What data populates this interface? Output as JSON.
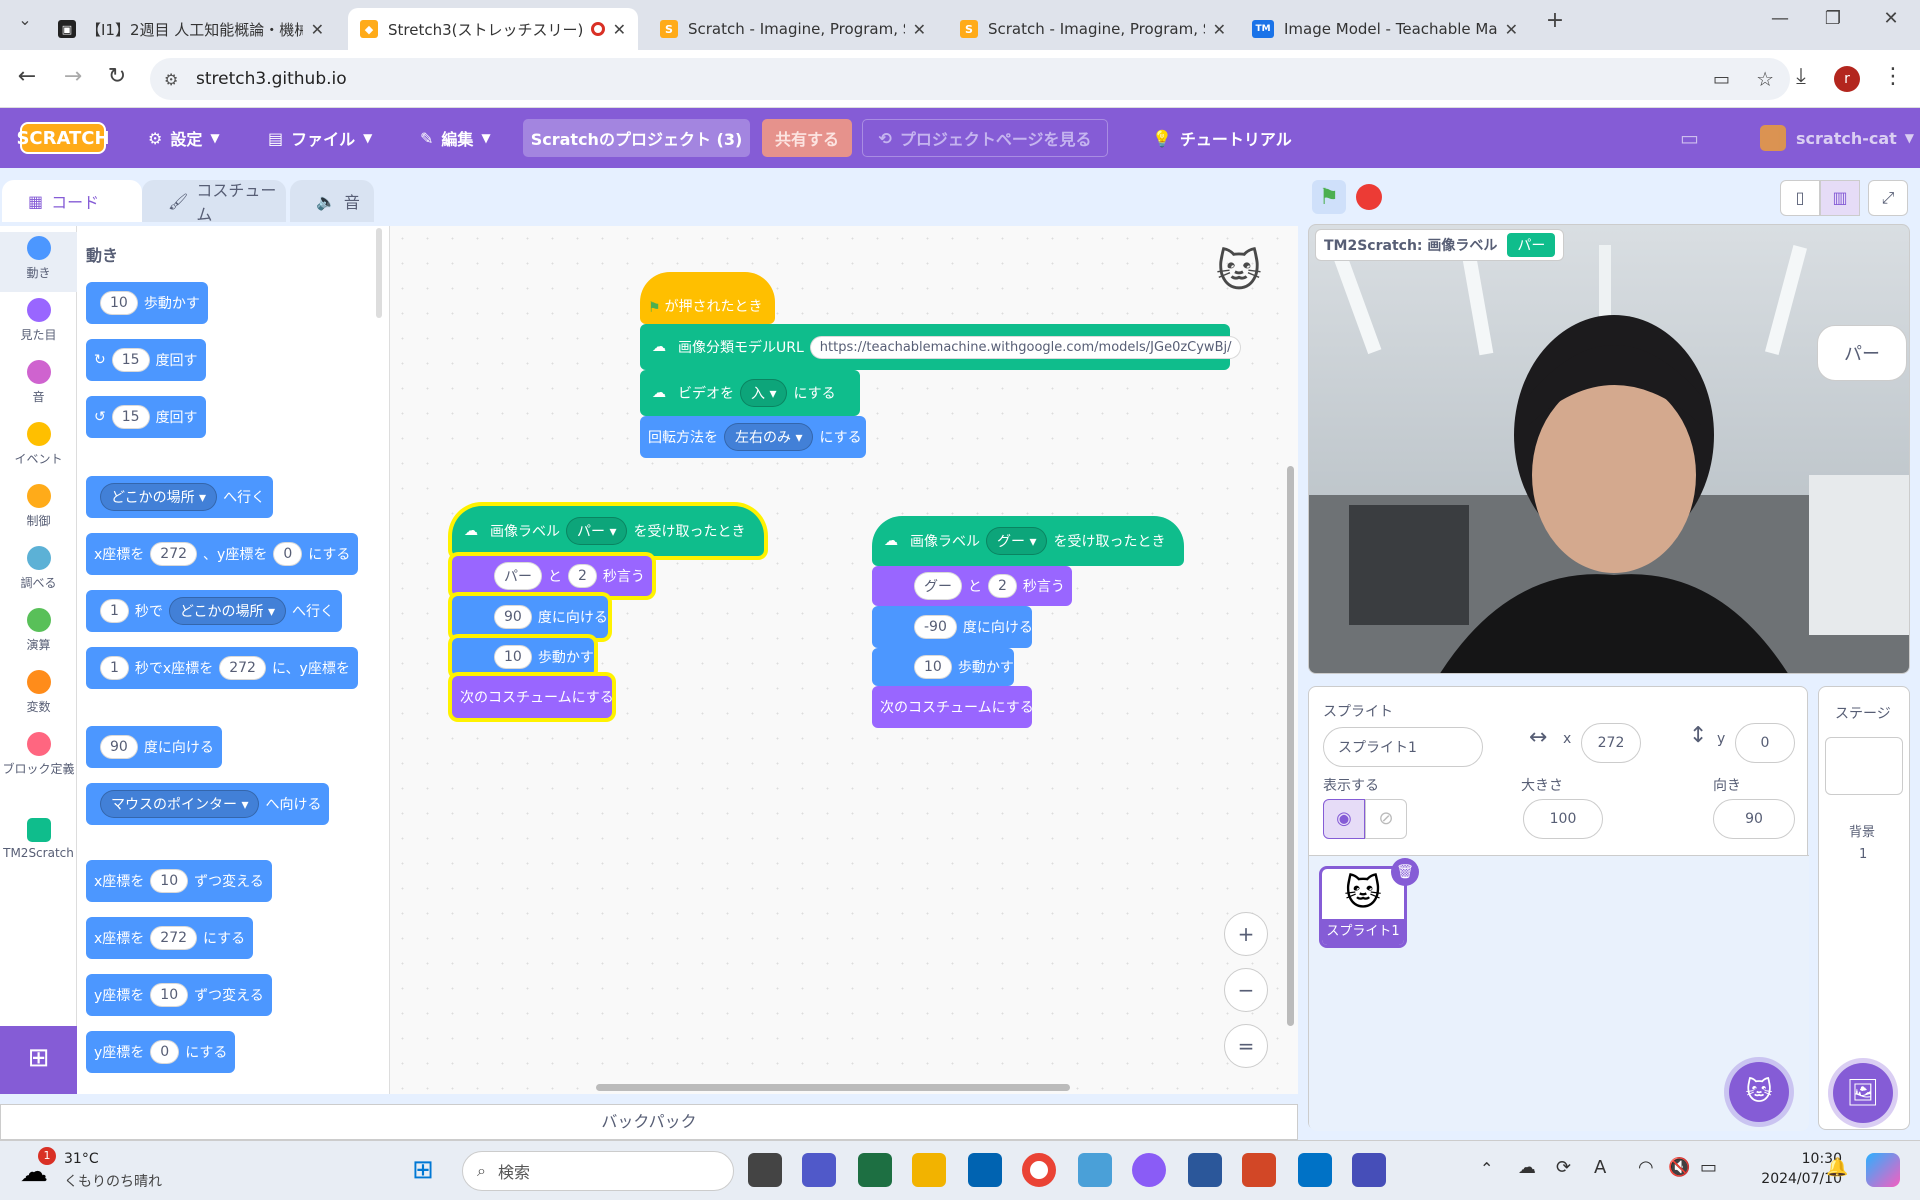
{
  "tabs": [
    {
      "title": "【I1】2週目 人工知能概論・機械学",
      "fav_color": "#222",
      "fav": "▣"
    },
    {
      "title": "Stretch3(ストレッチスリー)",
      "fav_color": "#ffab19",
      "fav": "🐱"
    },
    {
      "title": "Scratch - Imagine, Program, Sha",
      "fav_color": "#ffab19",
      "fav": "S"
    },
    {
      "title": "Scratch - Imagine, Program, Sha",
      "fav_color": "#ffab19",
      "fav": "S"
    },
    {
      "title": "Image Model - Teachable Mach",
      "fav_color": "#1a73e8",
      "fav": "TM"
    }
  ],
  "address": "stretch3.github.io",
  "profile_initial": "r",
  "menu": {
    "logo": "SCRATCH",
    "settings": "設定",
    "file": "ファイル",
    "edit": "編集",
    "project_title": "Scratchのプロジェクト (3)",
    "share": "共有する",
    "see_project": "プロジェクトページを見る",
    "tutorial": "チュートリアル",
    "user": "scratch-cat"
  },
  "editor_tabs": {
    "code": "コード",
    "costume": "コスチューム",
    "sound": "音"
  },
  "categories": [
    {
      "label": "動き",
      "color": "#4c97ff"
    },
    {
      "label": "見た目",
      "color": "#9966ff"
    },
    {
      "label": "音",
      "color": "#cf63cf"
    },
    {
      "label": "イベント",
      "color": "#ffbf00"
    },
    {
      "label": "制御",
      "color": "#ffab19"
    },
    {
      "label": "調べる",
      "color": "#5cb1d6"
    },
    {
      "label": "演算",
      "color": "#59c059"
    },
    {
      "label": "変数",
      "color": "#ff8c1a"
    },
    {
      "label": "ブロック定義",
      "color": "#ff6680"
    },
    {
      "label": "TM2Scratch",
      "color": "#0fbd8c"
    }
  ],
  "palette": {
    "heading": "動き",
    "move": {
      "val": "10",
      "text": "歩動かす"
    },
    "turn_right": {
      "val": "15",
      "text": "度回す"
    },
    "turn_left": {
      "val": "15",
      "text": "度回す"
    },
    "goto": {
      "dd": "どこかの場所",
      "text": "へ行く"
    },
    "gotoxy": {
      "a": "x座標を",
      "x": "272",
      "b": "、y座標を",
      "y": "0",
      "c": "にする"
    },
    "glide": {
      "val": "1",
      "a": "秒で",
      "dd": "どこかの場所",
      "b": "へ行く"
    },
    "glidexy": {
      "val": "1",
      "a": "秒でx座標を",
      "x": "272",
      "b": "に、y座標を"
    },
    "point": {
      "val": "90",
      "text": "度に向ける"
    },
    "towards": {
      "dd": "マウスのポインター",
      "text": "へ向ける"
    },
    "changex": {
      "a": "x座標を",
      "val": "10",
      "b": "ずつ変える"
    },
    "setx": {
      "a": "x座標を",
      "val": "272",
      "b": "にする"
    },
    "changey": {
      "a": "y座標を",
      "val": "10",
      "b": "ずつ変える"
    },
    "sety": {
      "a": "y座標を",
      "val": "0",
      "b": "にする"
    }
  },
  "script": {
    "flag_hat": "が押されたとき",
    "model_url_label": "画像分類モデルURL",
    "model_url": "https://teachablemachine.withgoogle.com/models/JGe0zCywBj/",
    "video_a": "ビデオを",
    "video_dd": "入",
    "video_b": "にする",
    "rot_a": "回転方法を",
    "rot_dd": "左右のみ",
    "rot_b": "にする",
    "g1": {
      "hat_a": "画像ラベル",
      "hat_dd": "パー",
      "hat_b": "を受け取ったとき",
      "say": "パー",
      "to": "と",
      "secs": "2",
      "say_b": "秒言う",
      "dir": "90",
      "dir_b": "度に向ける",
      "move": "10",
      "move_b": "歩動かす",
      "next": "次のコスチュームにする"
    },
    "g2": {
      "hat_a": "画像ラベル",
      "hat_dd": "グー",
      "hat_b": "を受け取ったとき",
      "say": "グー",
      "to": "と",
      "secs": "2",
      "say_b": "秒言う",
      "dir": "-90",
      "dir_b": "度に向ける",
      "move": "10",
      "move_b": "歩動かす",
      "next": "次のコスチュームにする"
    }
  },
  "zoom": {
    "in": "+",
    "out": "−",
    "reset": "="
  },
  "backpack": "バックパック",
  "stage": {
    "monitor_label": "TM2Scratch: 画像ラベル",
    "monitor_value": "パー",
    "speech": "パー"
  },
  "sprite_info": {
    "header": "スプライト",
    "name": "スプライト1",
    "x_label": "x",
    "x": "272",
    "y_label": "y",
    "y": "0",
    "show_label": "表示する",
    "size_label": "大きさ",
    "size": "100",
    "dir_label": "向き",
    "dir": "90",
    "thumb_name": "スプライト1"
  },
  "stage_pane": {
    "title": "ステージ",
    "backdrop_label": "背景",
    "backdrop_count": "1"
  },
  "taskbar": {
    "weather_temp": "31°C",
    "weather_text": "くもりのち晴れ",
    "weather_badge": "1",
    "search": "検索",
    "time": "10:30",
    "date": "2024/07/10"
  }
}
